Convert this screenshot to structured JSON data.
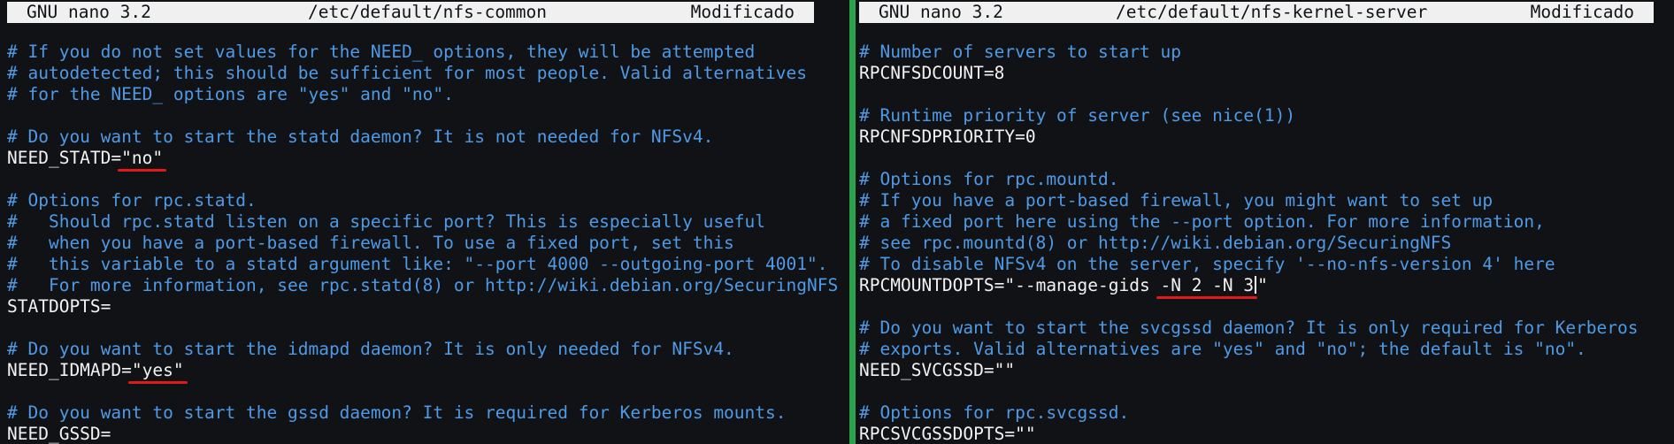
{
  "left": {
    "app": "GNU nano 3.2",
    "file": "/etc/default/nfs-common",
    "state": "Modificado",
    "lines": [
      {
        "t": "c",
        "text": "# If you do not set values for the NEED_ options, they will be attempted"
      },
      {
        "t": "c",
        "text": "# autodetected; this should be sufficient for most people. Valid alternatives"
      },
      {
        "t": "c",
        "text": "# for the NEED_ options are \"yes\" and \"no\"."
      },
      {
        "t": "b",
        "text": ""
      },
      {
        "t": "c",
        "text": "# Do you want to start the statd daemon? It is not needed for NFSv4."
      },
      {
        "t": "k",
        "prefix": "NEED_STATD=",
        "highlight": "\"no\"",
        "suffix": ""
      },
      {
        "t": "b",
        "text": ""
      },
      {
        "t": "c",
        "text": "# Options for rpc.statd."
      },
      {
        "t": "c",
        "text": "#   Should rpc.statd listen on a specific port? This is especially useful"
      },
      {
        "t": "c",
        "text": "#   when you have a port-based firewall. To use a fixed port, set this"
      },
      {
        "t": "c",
        "text": "#   this variable to a statd argument like: \"--port 4000 --outgoing-port 4001\"."
      },
      {
        "t": "c",
        "text": "#   For more information, see rpc.statd(8) or http://wiki.debian.org/SecuringNFS"
      },
      {
        "t": "k",
        "prefix": "STATDOPTS=",
        "highlight": "",
        "suffix": ""
      },
      {
        "t": "b",
        "text": ""
      },
      {
        "t": "c",
        "text": "# Do you want to start the idmapd daemon? It is only needed for NFSv4."
      },
      {
        "t": "k",
        "prefix": "NEED_IDMAPD=",
        "highlight": "\"yes\"",
        "suffix": ""
      },
      {
        "t": "b",
        "text": ""
      },
      {
        "t": "c",
        "text": "# Do you want to start the gssd daemon? It is required for Kerberos mounts."
      },
      {
        "t": "k",
        "prefix": "NEED_GSSD=",
        "highlight": "",
        "suffix": ""
      }
    ]
  },
  "right": {
    "app": "GNU nano 3.2",
    "file": "/etc/default/nfs-kernel-server",
    "state": "Modificado",
    "lines": [
      {
        "t": "c",
        "text": "# Number of servers to start up"
      },
      {
        "t": "k",
        "prefix": "RPCNFSDCOUNT=8",
        "highlight": "",
        "suffix": ""
      },
      {
        "t": "b",
        "text": ""
      },
      {
        "t": "c",
        "text": "# Runtime priority of server (see nice(1))"
      },
      {
        "t": "k",
        "prefix": "RPCNFSDPRIORITY=0",
        "highlight": "",
        "suffix": ""
      },
      {
        "t": "b",
        "text": ""
      },
      {
        "t": "c",
        "text": "# Options for rpc.mountd."
      },
      {
        "t": "c",
        "text": "# If you have a port-based firewall, you might want to set up"
      },
      {
        "t": "c",
        "text": "# a fixed port here using the --port option. For more information,"
      },
      {
        "t": "c",
        "text": "# see rpc.mountd(8) or http://wiki.debian.org/SecuringNFS"
      },
      {
        "t": "c",
        "text": "# To disable NFSv4 on the server, specify '--no-nfs-version 4' here"
      },
      {
        "t": "k",
        "prefix": "RPCMOUNTDOPTS=\"--manage-gids ",
        "highlight": "-N 2 -N 3",
        "suffix": "\"",
        "cursor": true
      },
      {
        "t": "b",
        "text": ""
      },
      {
        "t": "c",
        "text": "# Do you want to start the svcgssd daemon? It is only required for Kerberos"
      },
      {
        "t": "c",
        "text": "# exports. Valid alternatives are \"yes\" and \"no\"; the default is \"no\"."
      },
      {
        "t": "k",
        "prefix": "NEED_SVCGSSD=\"\"",
        "highlight": "",
        "suffix": ""
      },
      {
        "t": "b",
        "text": ""
      },
      {
        "t": "c",
        "text": "# Options for rpc.svcgssd."
      },
      {
        "t": "k",
        "prefix": "RPCSVCGSSDOPTS=\"\"",
        "highlight": "",
        "suffix": ""
      }
    ]
  },
  "colors": {
    "comment": "#4f9ae6",
    "code": "#f2f2f2",
    "background": "#111216",
    "divider": "#2ba24b",
    "underline": "#e0191b"
  }
}
